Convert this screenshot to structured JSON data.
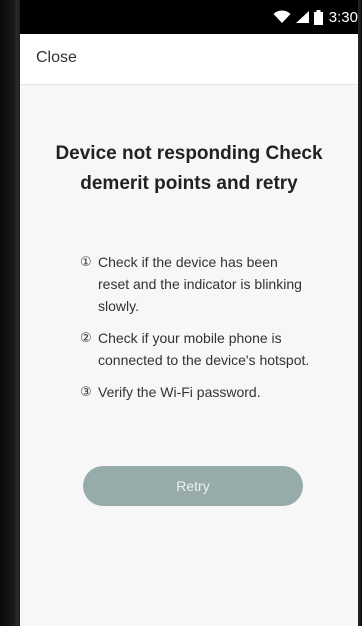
{
  "status_bar": {
    "time": "3:30",
    "icons": [
      "wifi-icon",
      "signal-icon",
      "battery-icon"
    ]
  },
  "toolbar": {
    "close_label": "Close"
  },
  "main": {
    "title": "Device not responding Check demerit points and retry",
    "steps": [
      {
        "num": "①",
        "text": "Check if the device has been reset and the indicator is blinking slowly."
      },
      {
        "num": "②",
        "text": "Check if your mobile phone is connected to the device's hotspot."
      },
      {
        "num": "③",
        "text": "Verify the Wi-Fi password."
      }
    ],
    "retry_label": "Retry"
  },
  "colors": {
    "retry_button_bg": "#97acaa",
    "background": "#f7f7f7",
    "status_bar_bg": "#000000"
  }
}
